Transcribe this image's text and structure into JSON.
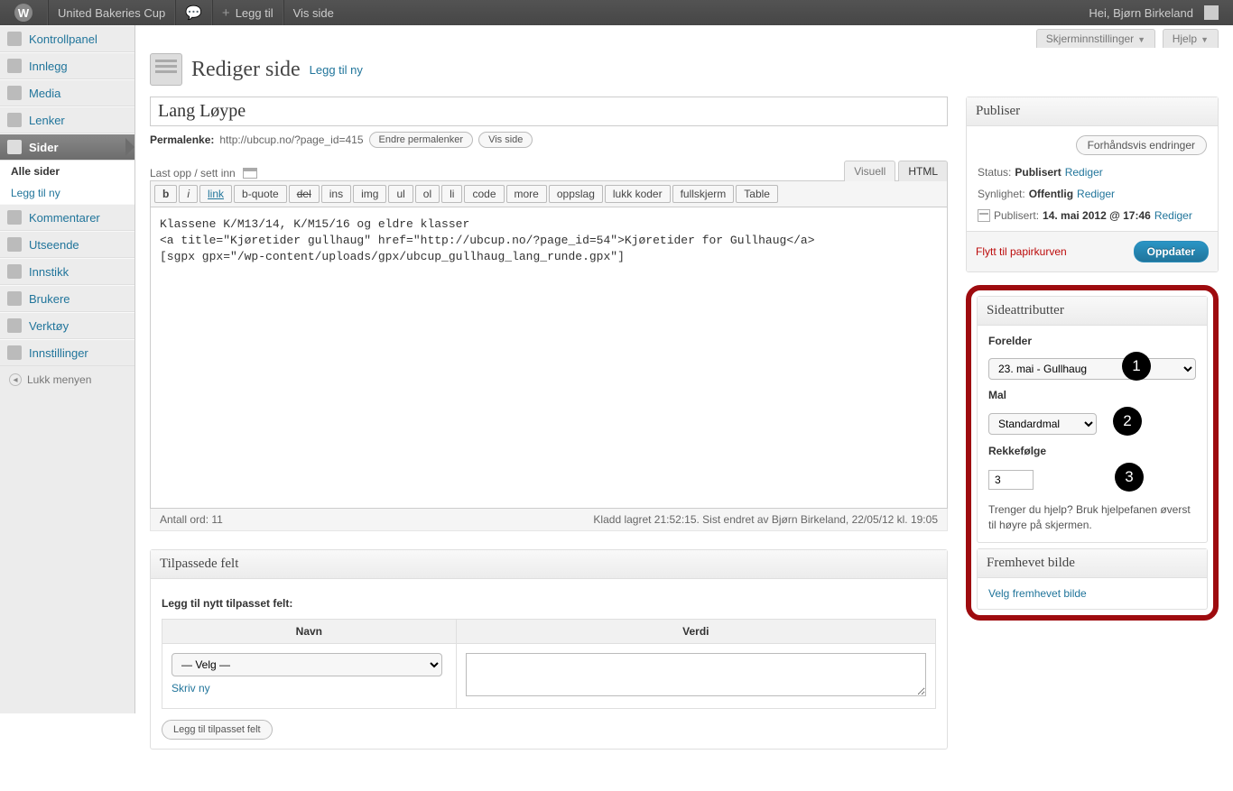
{
  "adminbar": {
    "site_name": "United Bakeries Cup",
    "add_new": "Legg til",
    "view_page": "Vis side",
    "greeting": "Hei, Bjørn Birkeland"
  },
  "top_tabs": {
    "screen_options": "Skjerminnstillinger",
    "help": "Hjelp"
  },
  "sidebar": {
    "items": [
      "Kontrollpanel",
      "Innlegg",
      "Media",
      "Lenker",
      "Sider",
      "Kommentarer",
      "Utseende",
      "Innstikk",
      "Brukere",
      "Verktøy",
      "Innstillinger"
    ],
    "submenu": {
      "all": "Alle sider",
      "add": "Legg til ny"
    },
    "collapse": "Lukk menyen"
  },
  "heading": {
    "title": "Rediger side",
    "add_new": "Legg til ny"
  },
  "post": {
    "title": "Lang Løype",
    "permalink_label": "Permalenke:",
    "permalink_url": "http://ubcup.no/?page_id=415",
    "edit_permalinks_btn": "Endre permalenker",
    "view_page_btn": "Vis side"
  },
  "editor": {
    "upload_label": "Last opp / sett inn",
    "tabs": {
      "visual": "Visuell",
      "html": "HTML"
    },
    "quicktags": [
      "b",
      "i",
      "link",
      "b-quote",
      "del",
      "ins",
      "img",
      "ul",
      "ol",
      "li",
      "code",
      "more",
      "oppslag",
      "lukk koder",
      "fullskjerm",
      "Table"
    ],
    "content": "Klassene K/M13/14, K/M15/16 og eldre klasser\n<a title=\"Kjøretider gullhaug\" href=\"http://ubcup.no/?page_id=54\">Kjøretider for Gullhaug</a>\n[sgpx gpx=\"/wp-content/uploads/gpx/ubcup_gullhaug_lang_runde.gpx\"]",
    "word_count": "Antall ord: 11",
    "save_status": "Kladd lagret 21:52:15. Sist endret av Bjørn Birkeland, 22/05/12 kl. 19:05"
  },
  "publish": {
    "box_title": "Publiser",
    "preview_btn": "Forhåndsvis endringer",
    "status_label": "Status:",
    "status_value": "Publisert",
    "status_edit": "Rediger",
    "visibility_label": "Synlighet:",
    "visibility_value": "Offentlig",
    "visibility_edit": "Rediger",
    "published_label": "Publisert:",
    "published_value": "14. mai 2012 @ 17:46",
    "published_edit": "Rediger",
    "trash": "Flytt til papirkurven",
    "update": "Oppdater"
  },
  "attributes": {
    "box_title": "Sideattributter",
    "parent_label": "Forelder",
    "parent_value": "   23. mai - Gullhaug",
    "template_label": "Mal",
    "template_value": "Standardmal",
    "order_label": "Rekkefølge",
    "order_value": "3",
    "help_text": "Trenger du hjelp? Bruk hjelpefanen øverst til høyre på skjermen.",
    "callouts": {
      "one": "1",
      "two": "2",
      "three": "3"
    }
  },
  "featured": {
    "box_title": "Fremhevet bilde",
    "link": "Velg fremhevet bilde"
  },
  "custom_fields": {
    "box_title": "Tilpassede felt",
    "add_heading": "Legg til nytt tilpasset felt:",
    "col_name": "Navn",
    "col_value": "Verdi",
    "select_placeholder": "— Velg —",
    "enter_new": "Skriv ny",
    "add_btn": "Legg til tilpasset felt"
  }
}
